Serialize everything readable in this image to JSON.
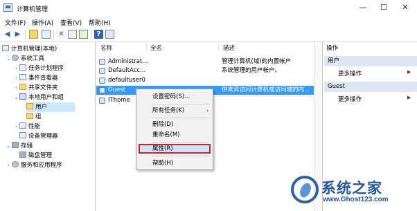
{
  "window": {
    "title": "计算机管理",
    "controls": {
      "minimize": "—",
      "maximize": "☐",
      "close": "✕"
    }
  },
  "menubar": {
    "items": [
      "文件(F)",
      "操作(A)",
      "查看(V)",
      "帮助(H)"
    ]
  },
  "toolbar": {
    "buttons": [
      "back-icon",
      "forward-icon",
      "up-folder-icon",
      "show-tree-icon",
      "delete-icon",
      "properties-icon",
      "export-icon",
      "help-icon",
      "console-icon"
    ]
  },
  "tree": {
    "root": "计算机管理(本地)",
    "items": [
      {
        "label": "系统工具"
      },
      {
        "label": "任务计划程序"
      },
      {
        "label": "事件查看器"
      },
      {
        "label": "共享文件夹"
      },
      {
        "label": "本地用户和组"
      },
      {
        "label": "用户"
      },
      {
        "label": "组"
      },
      {
        "label": "性能"
      },
      {
        "label": "设备管理器"
      },
      {
        "label": "存储"
      },
      {
        "label": "磁盘管理"
      },
      {
        "label": "服务和应用程序"
      }
    ]
  },
  "list": {
    "columns": [
      "名称",
      "全名",
      "描述"
    ],
    "rows": [
      {
        "name": "Administrat...",
        "fullname": "",
        "desc": "管理计算机(域)的内置帐户"
      },
      {
        "name": "DefaultAcc...",
        "fullname": "",
        "desc": "系统管理的用户帐户。"
      },
      {
        "name": "defaultuser0",
        "fullname": "",
        "desc": ""
      },
      {
        "name": "Guest",
        "fullname": "",
        "desc": "供来宾访问计算机或访问域的内..."
      },
      {
        "name": "IThome",
        "fullname": "",
        "desc": ""
      }
    ]
  },
  "context_menu": {
    "items": [
      "设置密码(S)...",
      "所有任务(K)",
      "删除(D)",
      "重命名(M)",
      "属性(R)",
      "帮助(H)"
    ]
  },
  "actions": {
    "title": "操作",
    "sections": [
      {
        "header": "用户",
        "items": [
          "更多操作"
        ]
      },
      {
        "header": "Guest",
        "items": [
          "更多操作"
        ]
      }
    ]
  },
  "watermark": {
    "brand": "系统之家",
    "url": "www.Ghost123.com"
  }
}
